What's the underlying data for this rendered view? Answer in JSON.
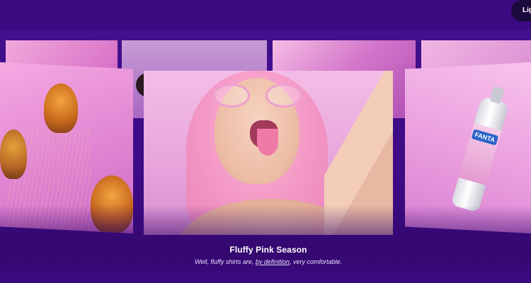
{
  "header": {
    "toggle_label": "Light",
    "accent": "#3b0a80"
  },
  "carousel": {
    "slides": [
      {
        "name": "jellyfish",
        "icon": "jellyfish-image"
      },
      {
        "name": "fluffy-pink-season",
        "icon": "portrait-image"
      },
      {
        "name": "fanta-bottle",
        "icon": "bottle-image"
      }
    ],
    "active": {
      "title": "Fluffy Pink Season",
      "text_before": "Well, fluffy shirts are, ",
      "link": "by definition",
      "text_after": ", very comfortable."
    },
    "bottle_brand": "FANTA"
  },
  "colors": {
    "background": "#3a0a8a",
    "pink": "#f3bde6",
    "caption_text": "#e9ddf8"
  }
}
